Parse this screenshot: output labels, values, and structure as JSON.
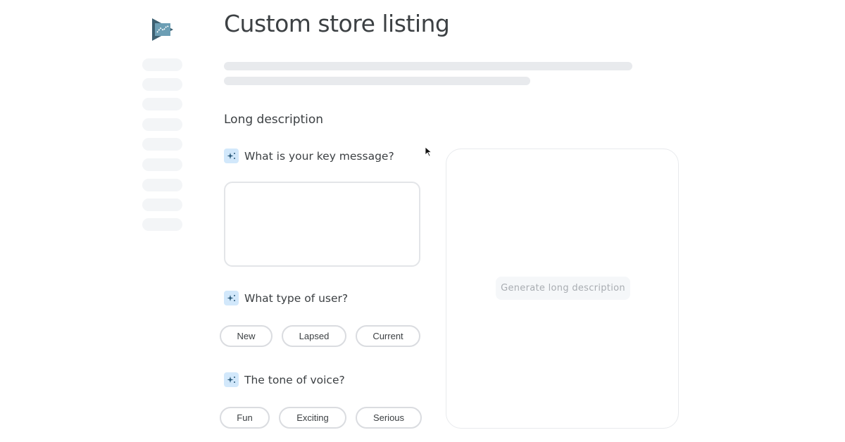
{
  "app": {
    "logo_icon": "play-console-logo-icon"
  },
  "sidebar": {
    "placeholder_count": 9
  },
  "header": {
    "title": "Custom store listing"
  },
  "section": {
    "title": "Long description",
    "key_message": {
      "label": "What is your key message?",
      "icon": "sparkle-icon",
      "value": "",
      "placeholder": ""
    },
    "user_type": {
      "label": "What type of user?",
      "icon": "sparkle-icon",
      "options": [
        "New",
        "Lapsed",
        "Current"
      ]
    },
    "tone": {
      "label": "The tone of voice?",
      "icon": "sparkle-icon",
      "options": [
        "Fun",
        "Exciting",
        "Serious"
      ]
    }
  },
  "panel": {
    "generate_label": "Generate long description"
  }
}
